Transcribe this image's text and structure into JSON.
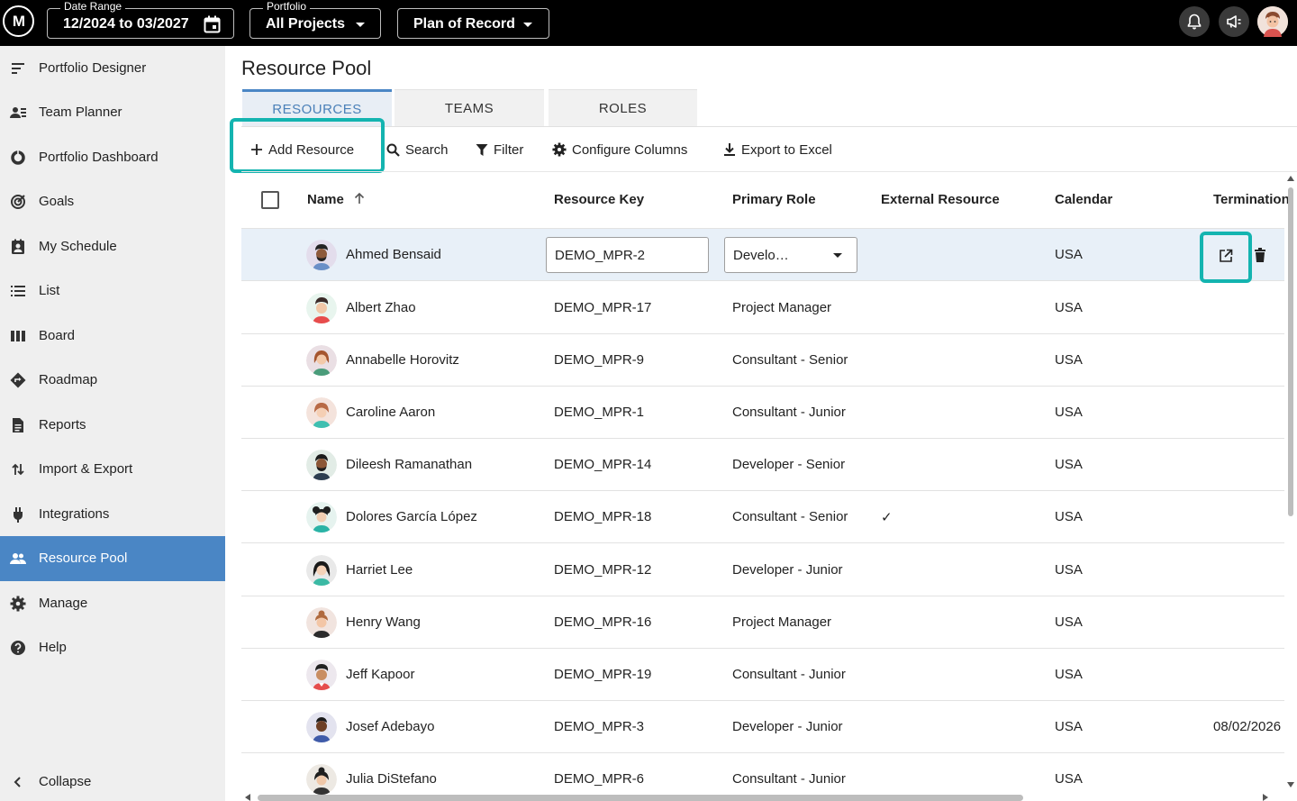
{
  "topbar": {
    "logo_text": "M",
    "date_range": {
      "legend": "Date Range",
      "value": "12/2024 to 03/2027"
    },
    "portfolio": {
      "legend": "Portfolio",
      "value": "All Projects"
    },
    "plan": {
      "value": "Plan of Record"
    }
  },
  "sidebar": {
    "items": [
      {
        "label": "Portfolio Designer",
        "icon": "sort-lines-icon"
      },
      {
        "label": "Team Planner",
        "icon": "person-lines-icon"
      },
      {
        "label": "Portfolio Dashboard",
        "icon": "donut-icon"
      },
      {
        "label": "Goals",
        "icon": "target-icon"
      },
      {
        "label": "My Schedule",
        "icon": "contact-calendar-icon"
      },
      {
        "label": "List",
        "icon": "list-icon"
      },
      {
        "label": "Board",
        "icon": "columns-icon"
      },
      {
        "label": "Roadmap",
        "icon": "diamond-arrow-icon"
      },
      {
        "label": "Reports",
        "icon": "document-icon"
      },
      {
        "label": "Import & Export",
        "icon": "swap-vertical-icon"
      },
      {
        "label": "Integrations",
        "icon": "plug-icon"
      },
      {
        "label": "Resource Pool",
        "icon": "people-icon",
        "active": true
      },
      {
        "label": "Manage",
        "icon": "gear-icon"
      },
      {
        "label": "Help",
        "icon": "help-icon"
      }
    ],
    "collapse_label": "Collapse"
  },
  "main": {
    "title": "Resource Pool",
    "tabs": [
      "RESOURCES",
      "TEAMS",
      "ROLES"
    ],
    "toolbar": {
      "add": "Add Resource",
      "search": "Search",
      "filter": "Filter",
      "configure": "Configure Columns",
      "export": "Export to Excel"
    },
    "columns": [
      "Name",
      "Resource Key",
      "Primary Role",
      "External Resource",
      "Calendar",
      "Termination"
    ],
    "rows": [
      {
        "name": "Ahmed Bensaid",
        "key": "DEMO_MPR-2",
        "role": "Develo…",
        "external": "",
        "calendar": "USA",
        "termination": ""
      },
      {
        "name": "Albert Zhao",
        "key": "DEMO_MPR-17",
        "role": "Project Manager",
        "external": "",
        "calendar": "USA",
        "termination": ""
      },
      {
        "name": "Annabelle Horovitz",
        "key": "DEMO_MPR-9",
        "role": "Consultant - Senior",
        "external": "",
        "calendar": "USA",
        "termination": ""
      },
      {
        "name": "Caroline Aaron",
        "key": "DEMO_MPR-1",
        "role": "Consultant - Junior",
        "external": "",
        "calendar": "USA",
        "termination": ""
      },
      {
        "name": "Dileesh Ramanathan",
        "key": "DEMO_MPR-14",
        "role": "Developer - Senior",
        "external": "",
        "calendar": "USA",
        "termination": ""
      },
      {
        "name": "Dolores García López",
        "key": "DEMO_MPR-18",
        "role": "Consultant - Senior",
        "external": "✓",
        "calendar": "USA",
        "termination": ""
      },
      {
        "name": "Harriet Lee",
        "key": "DEMO_MPR-12",
        "role": "Developer - Junior",
        "external": "",
        "calendar": "USA",
        "termination": ""
      },
      {
        "name": "Henry Wang",
        "key": "DEMO_MPR-16",
        "role": "Project Manager",
        "external": "",
        "calendar": "USA",
        "termination": ""
      },
      {
        "name": "Jeff Kapoor",
        "key": "DEMO_MPR-19",
        "role": "Consultant - Junior",
        "external": "",
        "calendar": "USA",
        "termination": ""
      },
      {
        "name": "Josef Adebayo",
        "key": "DEMO_MPR-3",
        "role": "Developer - Junior",
        "external": "",
        "calendar": "USA",
        "termination": "08/02/2026"
      },
      {
        "name": "Julia DiStefano",
        "key": "DEMO_MPR-6",
        "role": "Consultant - Junior",
        "external": "",
        "calendar": "USA",
        "termination": ""
      }
    ]
  },
  "colors": {
    "accent": "#4a86c5",
    "highlight": "#14b4b0",
    "topbar": "#000000"
  }
}
